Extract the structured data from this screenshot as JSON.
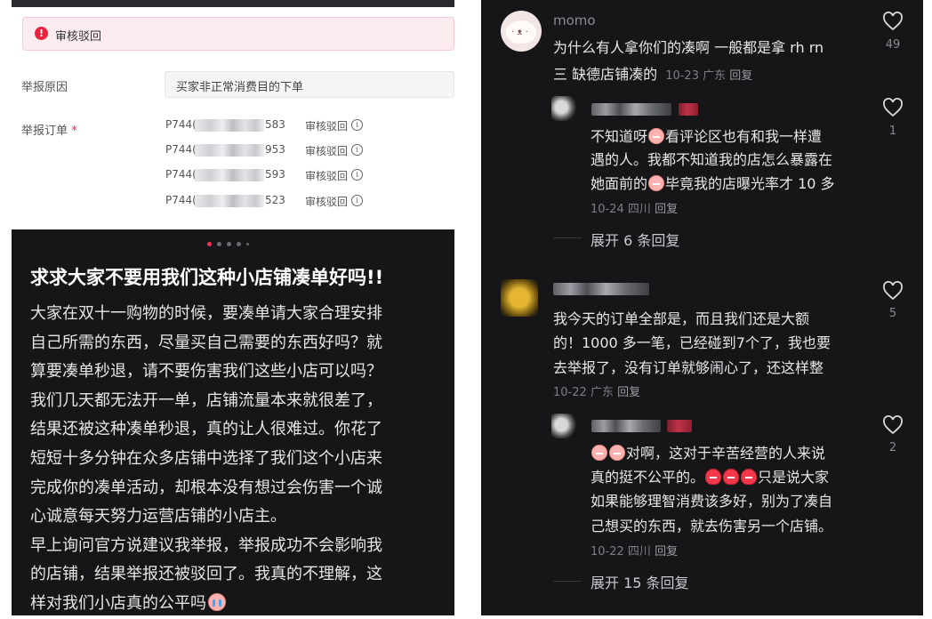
{
  "left_panel": {
    "screenshot": {
      "reject_banner": {
        "icon": "!",
        "text": "审核驳回"
      },
      "reason_label": "举报原因",
      "reason_value": "买家非正常消费目的下单",
      "orders_label": "举报订单",
      "required_mark": "*",
      "orders": [
        {
          "prefix": "P744(",
          "suffix": "583",
          "status": "审核驳回"
        },
        {
          "prefix": "P744(",
          "suffix": "953",
          "status": "审核驳回"
        },
        {
          "prefix": "P744(",
          "suffix": "593",
          "status": "审核驳回"
        },
        {
          "prefix": "P744(",
          "suffix": "523",
          "status": "审核驳回"
        }
      ],
      "info_glyph": "i"
    },
    "carousel": {
      "total": 5,
      "active": 0
    },
    "post": {
      "title": "求求大家不要用我们这种小店铺凑单好吗!!",
      "lines": [
        "大家在双十一购物的时候，要凑单请大家合理安排",
        "自己所需的东西，尽量买自己需要的东西好吗？就",
        "算要凑单秒退，请不要伤害我们这些小店可以吗？",
        "我们几天都无法开一单，店铺流量本来就很差了，",
        "结果还被这种凑单秒退，真的让人很难过。你花了",
        "短短十多分钟在众多店铺中选择了我们这个小店来",
        "完成你的凑单活动，却根本没有想过会伤害一个诚",
        "心诚意每天努力运营店铺的小店主。",
        "早上询问官方说建议我举报，举报成功不会影响我",
        "的店铺，结果举报还被驳回了。我真的不理解，这",
        "样对我们小店真的公平吗"
      ]
    }
  },
  "comments": [
    {
      "user": "momo",
      "lines": [
        "为什么有人拿你们的凑啊 一般都是拿 rh rn",
        "三 缺德店铺凑的"
      ],
      "date": "10-23",
      "location": "广东",
      "reply": "回复",
      "likes": "49",
      "replies": [
        {
          "lines": [
            "不知道呀",
            "看评论区也有和我一样遭",
            "遇的人。我都不知道我的店怎么暴露在",
            "她面前的",
            "毕竟我的店曝光率才 10 多"
          ],
          "date": "10-24",
          "location": "四川",
          "reply": "回复",
          "likes": "1"
        }
      ],
      "expand": "展开 6 条回复"
    },
    {
      "user": "",
      "lines": [
        "我今天的订单全部是，而且我们还是大额",
        "的！1000 多一笔，已经碰到7个了，我也要",
        "去举报了，没有订单就够闹心了，还这样整"
      ],
      "date": "10-22",
      "location": "广东",
      "reply": "回复",
      "likes": "5",
      "replies": [
        {
          "lines": [
            "对啊，这对于辛苦经营的人来说",
            "真的挺不公平的。",
            "只是说大家",
            "如果能够理智消费该多好，别为了凑自",
            "己想买的东西，就去伤害另一个店铺。"
          ],
          "date": "10-22",
          "location": "四川",
          "reply": "回复",
          "likes": "2"
        }
      ],
      "expand": "展开 15 条回复"
    }
  ],
  "colors": {
    "accent": "#fe2c55",
    "dark_bg": "#161618",
    "reject_red": "#e8243f"
  }
}
